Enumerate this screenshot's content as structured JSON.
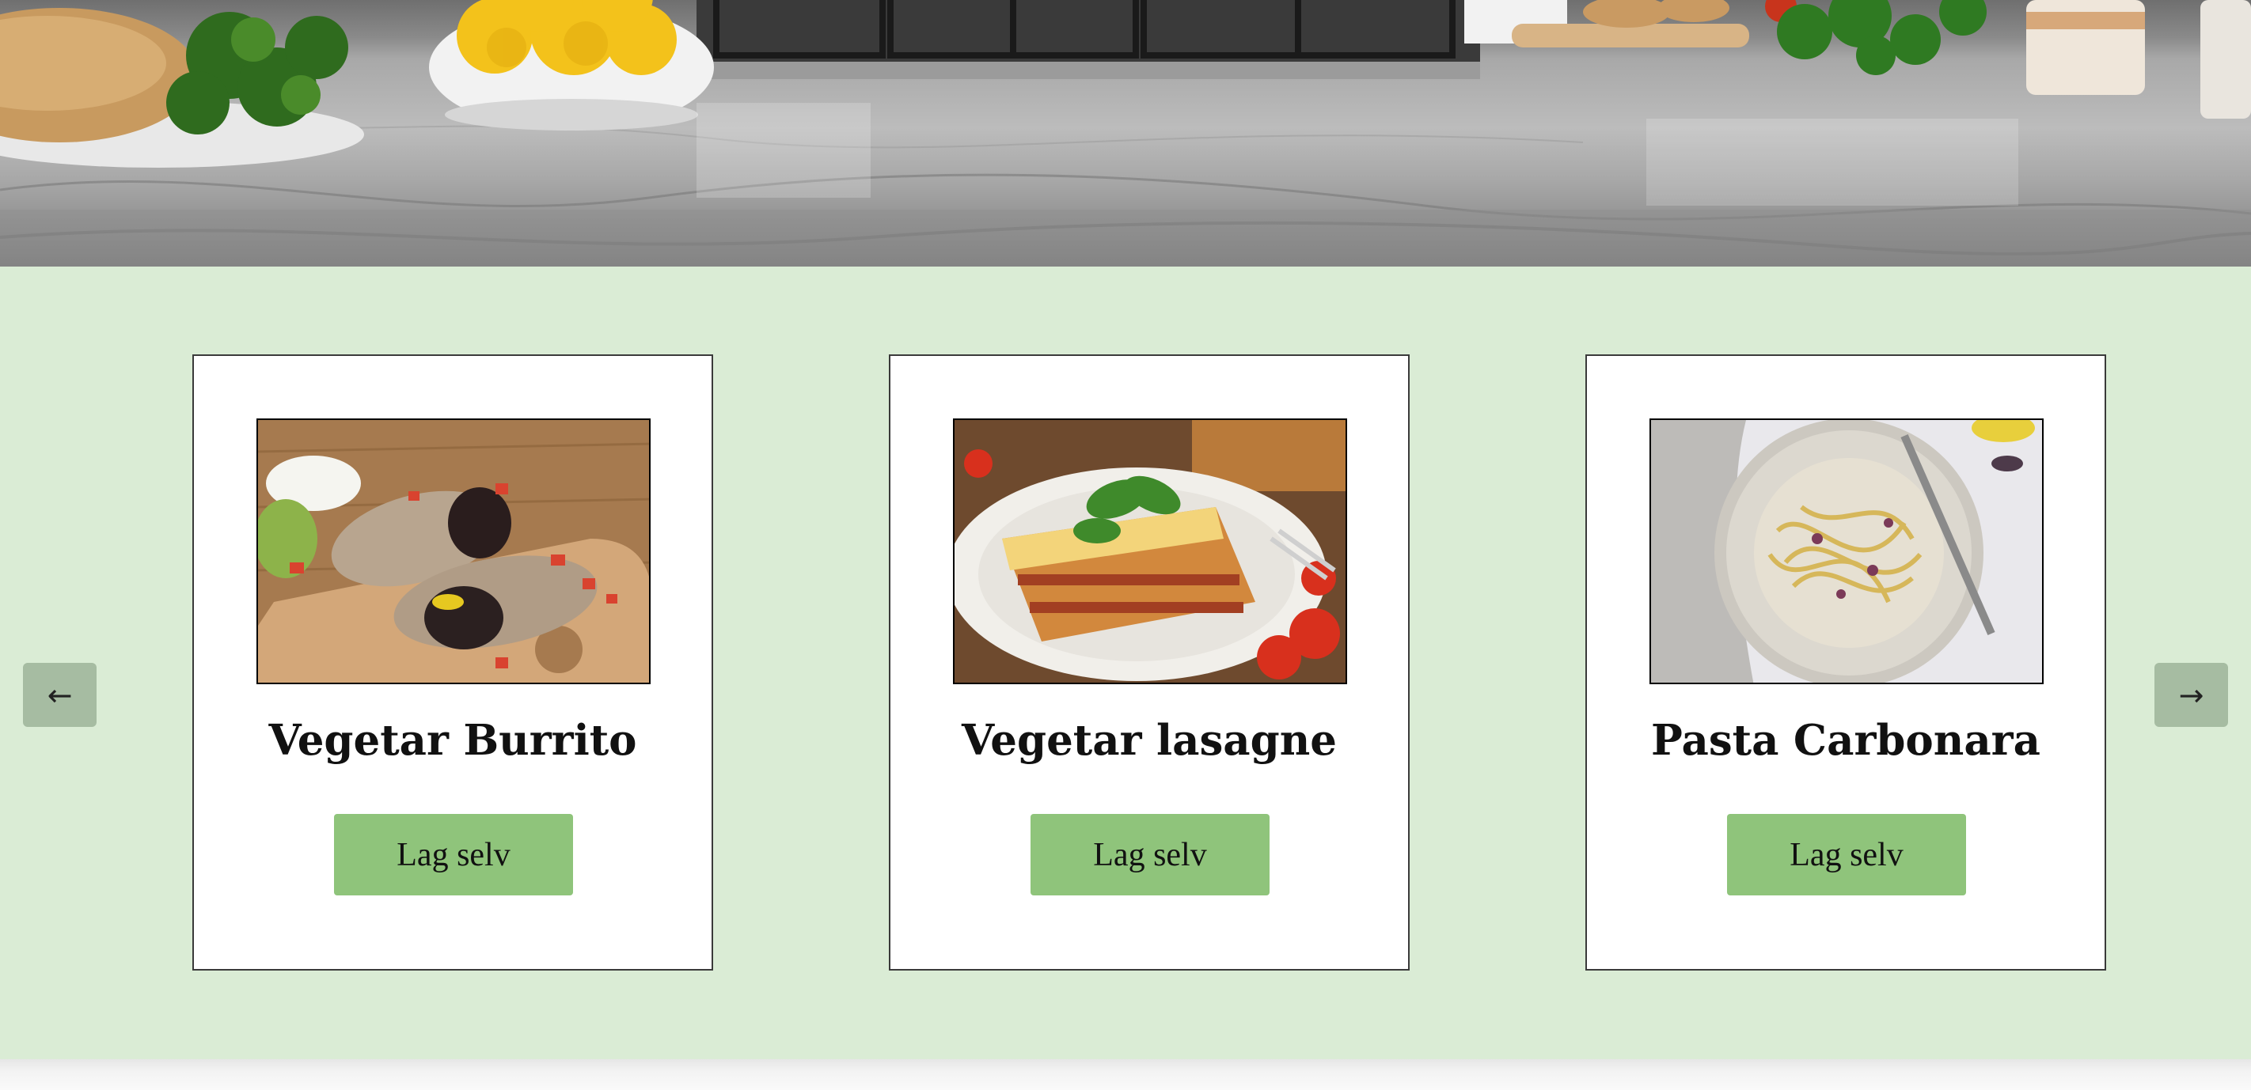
{
  "hero": {
    "image": "kitchen-countertop-photo"
  },
  "carousel": {
    "prev_label": "←",
    "next_label": "→",
    "cards": [
      {
        "title": "Vegetar Burrito",
        "button_label": "Lag selv",
        "image": "burrito-photo"
      },
      {
        "title": "Vegetar lasagne",
        "button_label": "Lag selv",
        "image": "lasagne-photo"
      },
      {
        "title": "Pasta Carbonara",
        "button_label": "Lag selv",
        "image": "carbonara-photo"
      }
    ]
  },
  "colors": {
    "section_background": "#daecd5",
    "button_green": "#8fc47b",
    "arrow_button": "#a6bca2",
    "card_border": "#3a3a3a"
  }
}
